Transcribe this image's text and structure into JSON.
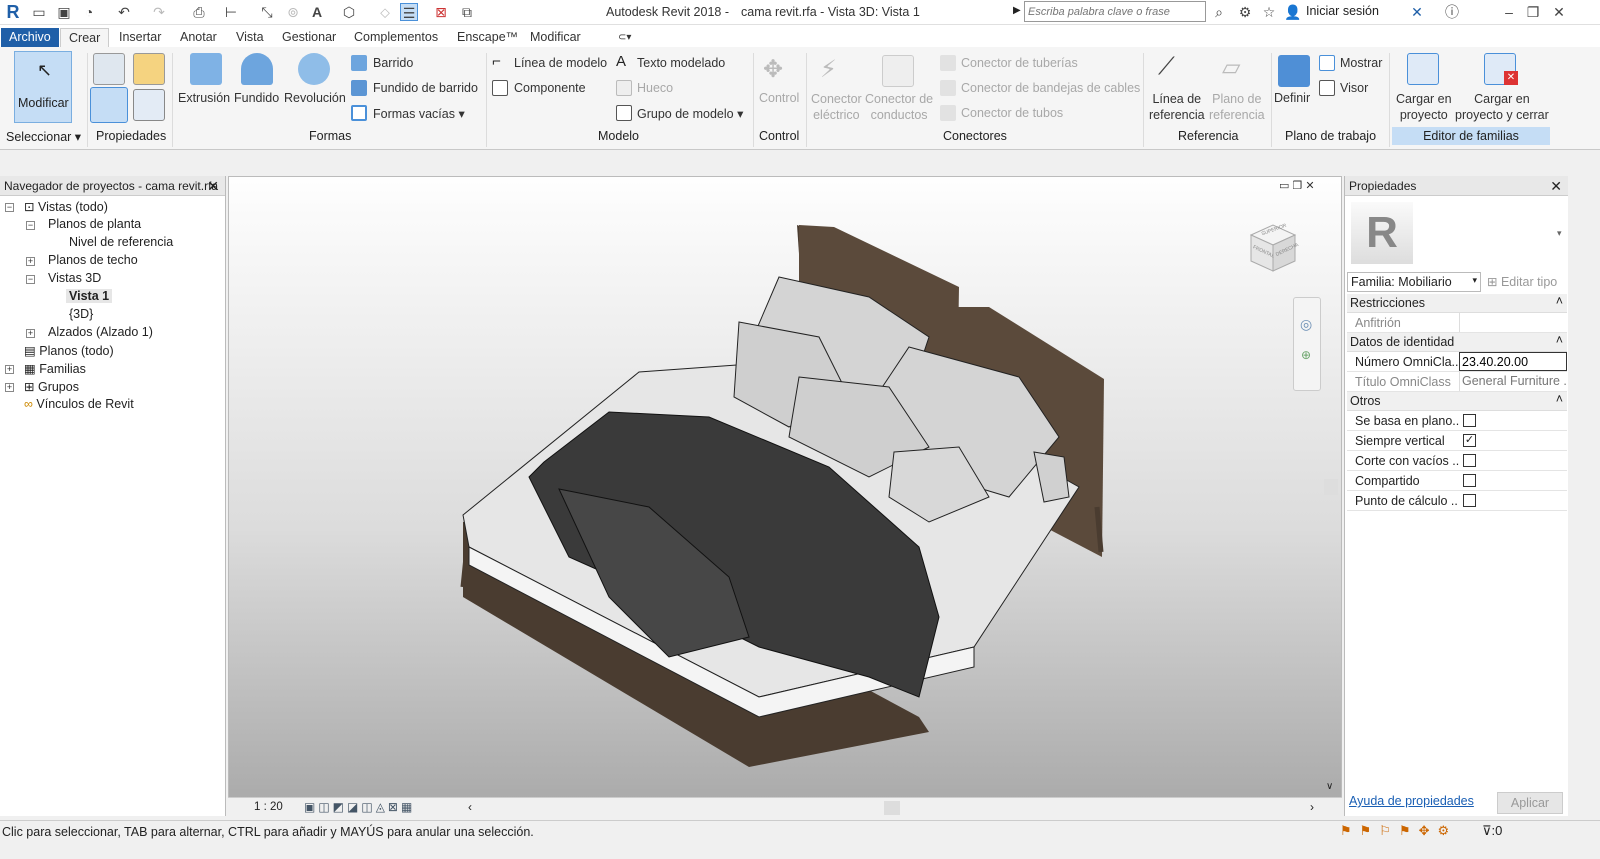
{
  "app": {
    "title": "Autodesk Revit 2018 -",
    "document": "cama revit.rfa - Vista 3D: Vista 1",
    "search_placeholder": "Escriba palabra clave o frase",
    "signin": "Iniciar sesión"
  },
  "tabs": [
    "Archivo",
    "Crear",
    "Insertar",
    "Anotar",
    "Vista",
    "Gestionar",
    "Complementos",
    "Enscape™",
    "Modificar"
  ],
  "ribbon": {
    "modify": "Modificar",
    "extrusion": "Extrusión",
    "blend": "Fundido",
    "revolve": "Revolución",
    "sweep": "Barrido",
    "swept_blend": "Fundido de barrido",
    "void_forms": "Formas vacías",
    "model_line": "Línea de modelo",
    "component": "Componente",
    "model_text": "Texto modelado",
    "opening": "Hueco",
    "model_group": "Grupo de modelo",
    "control": "Control",
    "elec_connector": [
      "Conector",
      "eléctrico"
    ],
    "duct_connector": [
      "Conector de",
      "conductos"
    ],
    "pipe_connector": "Conector de tuberías",
    "tray_connector": "Conector de bandejas de cables",
    "conduit_connector": "Conector de tubos",
    "ref_line": [
      "Línea de",
      "referencia"
    ],
    "ref_plane": [
      "Plano de",
      "referencia"
    ],
    "set": "Definir",
    "show": "Mostrar",
    "viewer": "Visor",
    "load_project": [
      "Cargar en",
      "proyecto"
    ],
    "load_close": [
      "Cargar en",
      "proyecto y cerrar"
    ],
    "panels": {
      "select": "Seleccionar",
      "properties": "Propiedades",
      "forms": "Formas",
      "model": "Modelo",
      "control": "Control",
      "connectors": "Conectores",
      "reference": "Referencia",
      "workplane": "Plano de trabajo",
      "family_editor": "Editor de familias"
    }
  },
  "browser": {
    "title": "Navegador de proyectos - cama revit.rfa",
    "items": [
      "Vistas (todo)",
      "Planos de planta",
      "Nivel de referencia",
      "Planos de techo",
      "Vistas 3D",
      "Vista 1",
      "{3D}",
      "Alzados (Alzado 1)",
      "Planos (todo)",
      "Familias",
      "Grupos",
      "Vínculos de Revit"
    ]
  },
  "viewcube": {
    "top": "SUPERIOR",
    "front": "FRONTAL",
    "right": "DERECHA"
  },
  "viewbar": {
    "scale": "1 : 20"
  },
  "properties": {
    "title": "Propiedades",
    "family": "Familia: Mobiliario",
    "edit_type": "Editar tipo",
    "groups": {
      "constraints": "Restricciones",
      "identity": "Datos de identidad",
      "others": "Otros"
    },
    "host_label": "Anfitrión",
    "host_value": "",
    "omni_num_label": "Número OmniCla...",
    "omni_num_value": "23.40.20.00",
    "omni_title_label": "Título OmniClass",
    "omni_title_value": "General Furniture ...",
    "others": [
      {
        "label": "Se basa en plano...",
        "checked": false
      },
      {
        "label": "Siempre vertical",
        "checked": true
      },
      {
        "label": "Corte con vacíos ...",
        "checked": false
      },
      {
        "label": "Compartido",
        "checked": false
      },
      {
        "label": "Punto de cálculo ...",
        "checked": false
      }
    ],
    "help": "Ayuda de propiedades",
    "apply": "Aplicar"
  },
  "status": {
    "message": "Clic para seleccionar, TAB para alternar, CTRL para añadir y MAYÚS para anular una selección.",
    "filter_count": ":0"
  }
}
